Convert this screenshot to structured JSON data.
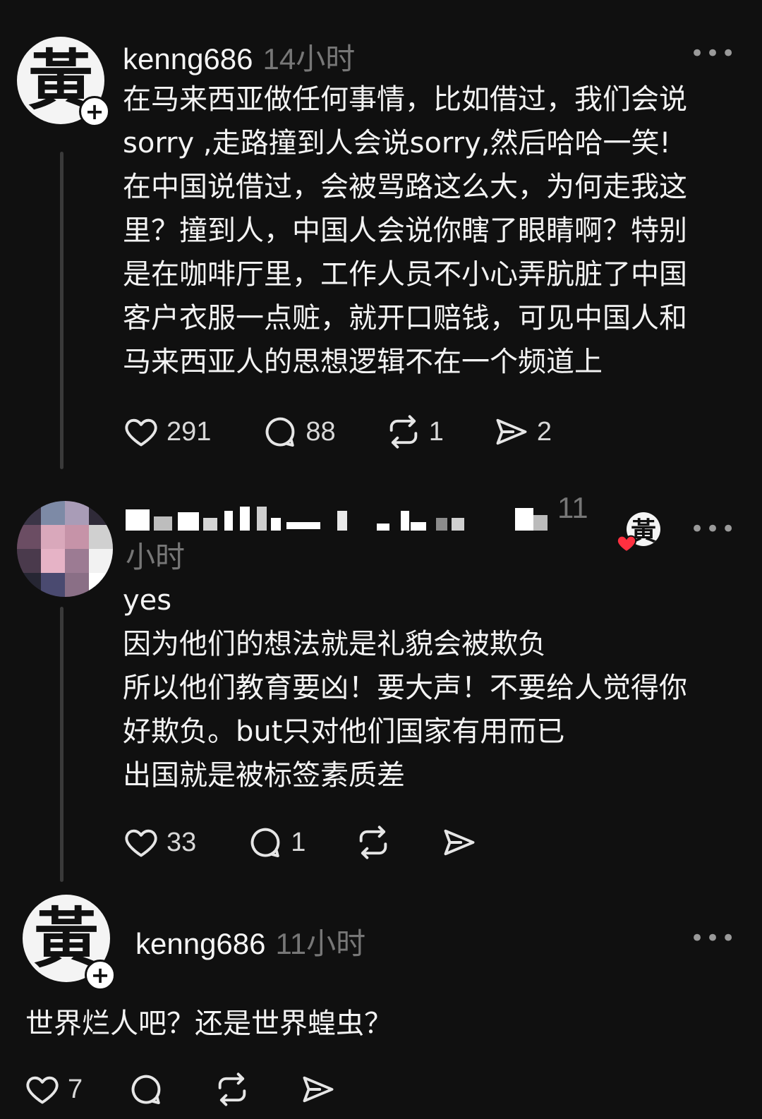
{
  "posts": [
    {
      "avatar_glyph": "黃",
      "username": "kenng686",
      "time": "14小时",
      "more": "•••",
      "text": "在马来西亚做任何事情，比如借过，我们会说\nsorry ,走路撞到人会说sorry,然后哈哈一笑!\n在中国说借过，会被骂路这么大，为何走我这\n里？撞到人，中国人会说你瞎了眼睛啊？特别\n是在咖啡厅里，工作人员不小心弄肮脏了中国\n客户衣服一点赃，就开口赔钱，可见中国人和\n马来西亚人的思想逻辑不在一个频道上",
      "likes": "291",
      "replies": "88",
      "reposts": "1",
      "shares": "2"
    },
    {
      "time_line1": "11",
      "time_line2": "小时",
      "liked_by_glyph": "黃",
      "more": "•••",
      "text": "yes\n因为他们的想法就是礼貌会被欺负\n所以他们教育要凶！要大声！不要给人觉得你\n好欺负。but只对他们国家有用而已\n出国就是被标签素质差",
      "likes": "33",
      "replies": "1"
    },
    {
      "avatar_glyph": "黃",
      "username": "kenng686",
      "time": "11小时",
      "more": "•••",
      "text": "世界烂人吧？还是世界蝗虫？",
      "likes": "7"
    }
  ],
  "icons": {
    "like": "heart-icon",
    "reply": "comment-icon",
    "repost": "repost-icon",
    "share": "share-icon",
    "follow": "plus-icon",
    "more": "more-icon"
  },
  "colors": {
    "background": "#101010",
    "text": "#f3f3f3",
    "muted": "#777777",
    "like_badge": "#ff3040"
  }
}
